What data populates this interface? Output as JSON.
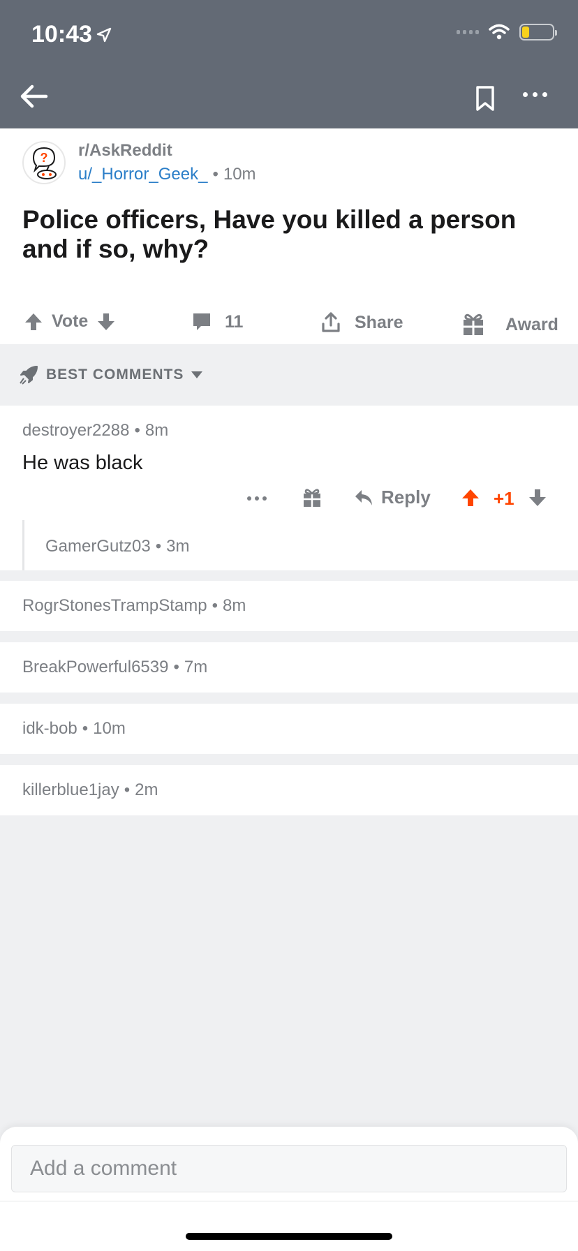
{
  "status_bar": {
    "time": "10:43"
  },
  "post": {
    "subreddit": "r/AskReddit",
    "author": "u/_Horror_Geek_",
    "age": "10m",
    "title": "Police officers, Have you killed a person and if so, why?",
    "actions": {
      "vote": "Vote",
      "comments": "11",
      "share": "Share",
      "award": "Award"
    }
  },
  "sort": {
    "label": "BEST COMMENTS"
  },
  "top_comment": {
    "author": "destroyer2288",
    "age": "8m",
    "body": "He was black",
    "reply_label": "Reply",
    "score": "+1",
    "reply": {
      "author": "GamerGutz03",
      "age": "3m"
    }
  },
  "collapsed_comments": [
    {
      "author": "RogrStonesTrampStamp",
      "age": "8m"
    },
    {
      "author": "BreakPowerful6539",
      "age": "7m"
    },
    {
      "author": "idk-bob",
      "age": "10m"
    },
    {
      "author": "killerblue1jay",
      "age": "2m"
    }
  ],
  "composer": {
    "placeholder": "Add a comment"
  },
  "colors": {
    "header": "#636a75",
    "upvote": "#ff4500",
    "link": "#2b7ec8",
    "background": "#eff0f2"
  }
}
